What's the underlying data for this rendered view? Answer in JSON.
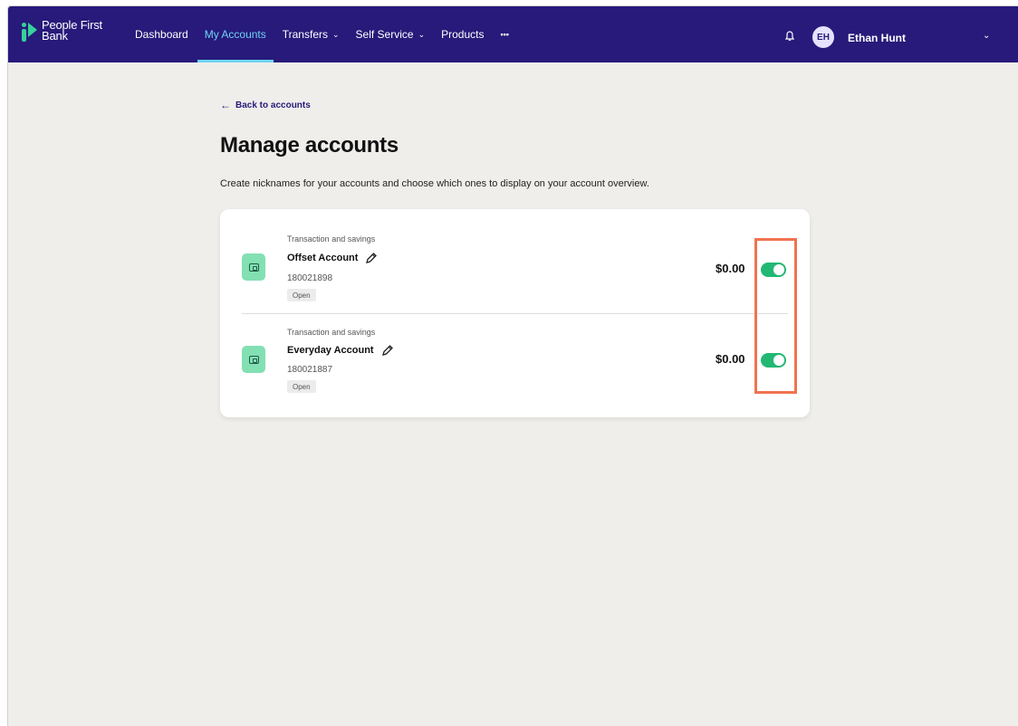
{
  "brand": {
    "line1": "People First",
    "line2": "Bank"
  },
  "nav": {
    "items": [
      {
        "label": "Dashboard"
      },
      {
        "label": "My Accounts",
        "active": true
      },
      {
        "label": "Transfers",
        "has_chevron": true
      },
      {
        "label": "Self Service",
        "has_chevron": true
      },
      {
        "label": "Products"
      },
      {
        "label": "•••"
      }
    ]
  },
  "user": {
    "initials": "EH",
    "name": "Ethan Hunt"
  },
  "back_link": {
    "label": "Back to accounts"
  },
  "page": {
    "title": "Manage accounts",
    "description": "Create nicknames for your accounts and choose which ones to display on your account overview."
  },
  "accounts": [
    {
      "type": "Transaction and savings",
      "name": "Offset Account",
      "number": "180021898",
      "status": "Open",
      "balance": "$0.00",
      "visible": true
    },
    {
      "type": "Transaction and savings",
      "name": "Everyday Account",
      "number": "180021887",
      "status": "Open",
      "balance": "$0.00",
      "visible": true
    }
  ],
  "icons": {
    "bell": "bell-icon",
    "chevron": "chevron-down-icon",
    "back": "arrow-left-icon",
    "account": "wallet-icon",
    "edit": "pencil-icon"
  },
  "colors": {
    "header_bg": "#271a7a",
    "active_nav": "#6fd3f5",
    "toggle_on": "#22b873",
    "account_icon_bg": "#82e0b3",
    "highlight_box": "#f07350"
  }
}
